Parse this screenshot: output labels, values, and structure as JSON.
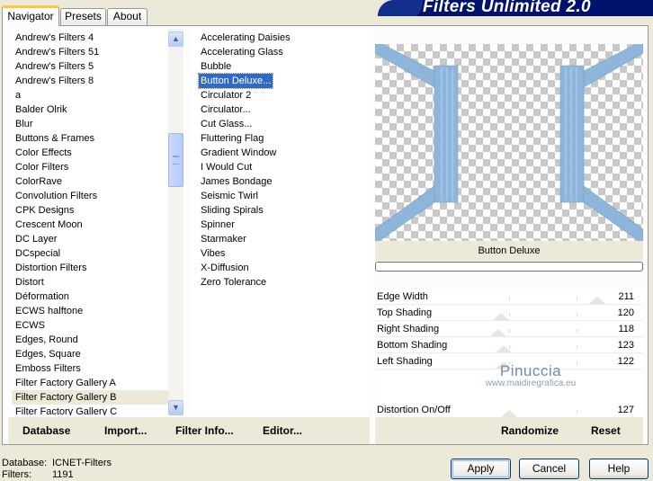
{
  "tabs": [
    {
      "label": "Navigator",
      "active": true
    },
    {
      "label": "Presets",
      "active": false
    },
    {
      "label": "About",
      "active": false
    }
  ],
  "banner_title": "Filters Unlimited 2.0",
  "categories": [
    "Andrew's Filters 4",
    "Andrew's Filters 51",
    "Andrew's Filters 5",
    "Andrew's Filters 8",
    "a",
    "Balder Olrik",
    "Blur",
    "Buttons & Frames",
    "Color Effects",
    "Color Filters",
    "ColorRave",
    "Convolution Filters",
    "CPK Designs",
    "Crescent Moon",
    "DC Layer",
    "DCspecial",
    "Distortion Filters",
    "Distort",
    "Déformation",
    "ECWS halftone",
    "ECWS",
    "Edges, Round",
    "Edges, Square",
    "Emboss Filters",
    "Filter Factory Gallery A",
    "Filter Factory Gallery B",
    "Filter Factory Gallery C"
  ],
  "selected_category": "Filter Factory Gallery B",
  "filters": [
    "Accelerating Daisies",
    "Accelerating Glass",
    "Bubble",
    "Button Deluxe...",
    "Circulator 2",
    "Circulator...",
    "Cut Glass...",
    "Fluttering Flag",
    "Gradient Window",
    "I Would Cut",
    "James Bondage",
    "Seismic Twirl",
    "Sliding Spirals",
    "Spinner",
    "Starmaker",
    "Vibes",
    "X-Diffusion",
    "Zero Tolerance"
  ],
  "selected_filter": "Button Deluxe...",
  "filter_name": "Button Deluxe",
  "params": [
    {
      "label": "Edge Width",
      "value": "211",
      "level": 0.83
    },
    {
      "label": "Top Shading",
      "value": "120",
      "level": 0.47
    },
    {
      "label": "Right Shading",
      "value": "118",
      "level": 0.46
    },
    {
      "label": "Bottom Shading",
      "value": "123",
      "level": 0.48
    },
    {
      "label": "Left Shading",
      "value": "122",
      "level": 0.48
    }
  ],
  "distortion": {
    "label": "Distortion On/Off",
    "value": "127",
    "level": 0.5
  },
  "watermark": {
    "line1": "Pinuccia",
    "line2": "www.maidiregrafica.eu"
  },
  "toolbar": {
    "database": "Database",
    "import": "Import...",
    "filter_info": "Filter Info...",
    "editor": "Editor...",
    "randomize": "Randomize",
    "reset": "Reset"
  },
  "status": {
    "database_label": "Database:",
    "database_value": "ICNET-Filters",
    "filters_label": "Filters:",
    "filters_value": "1191"
  },
  "buttons": {
    "apply": "Apply",
    "cancel": "Cancel",
    "help": "Help"
  },
  "colors": {
    "preview_band": "#8AB4DC",
    "selection": "#316AC5",
    "banner": "#00126B"
  }
}
